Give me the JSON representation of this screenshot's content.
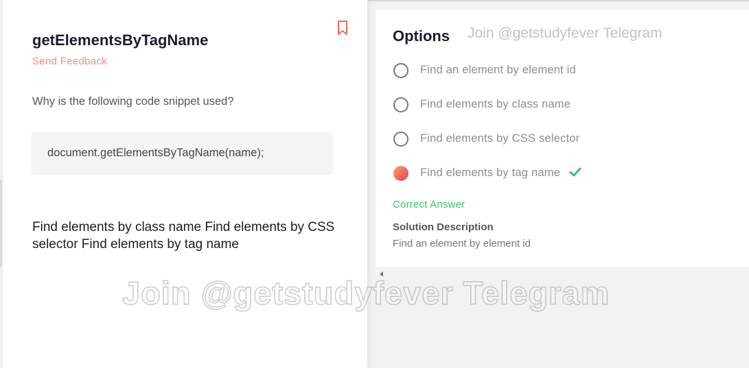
{
  "question": {
    "title": "getElementsByTagName",
    "feedback_label": "Send Feedback",
    "prompt": "Why is the following code snippet used?",
    "code": "document.getElementsByTagName(name);",
    "answer_text": "Find elements by class name Find elements by CSS selector Find elements by tag name",
    "bookmark_icon": "bookmark-icon"
  },
  "options_panel": {
    "title": "Options",
    "watermark": "Join @getstudyfever Telegram",
    "options": [
      {
        "label": "Find an element by element id",
        "selected": false
      },
      {
        "label": "Find elements by class name",
        "selected": false
      },
      {
        "label": "Find elements by CSS selector",
        "selected": false
      },
      {
        "label": "Find elements by tag name",
        "selected": true,
        "correct": true
      }
    ],
    "correct_label": "Correct Answer",
    "solution_title": "Solution Description",
    "solution_text": "Find an element by element id"
  },
  "watermark": "Join @getstudyfever Telegram",
  "colors": {
    "accent": "#f3675f",
    "feedback": "#f08a80",
    "correct": "#3bbf68"
  }
}
